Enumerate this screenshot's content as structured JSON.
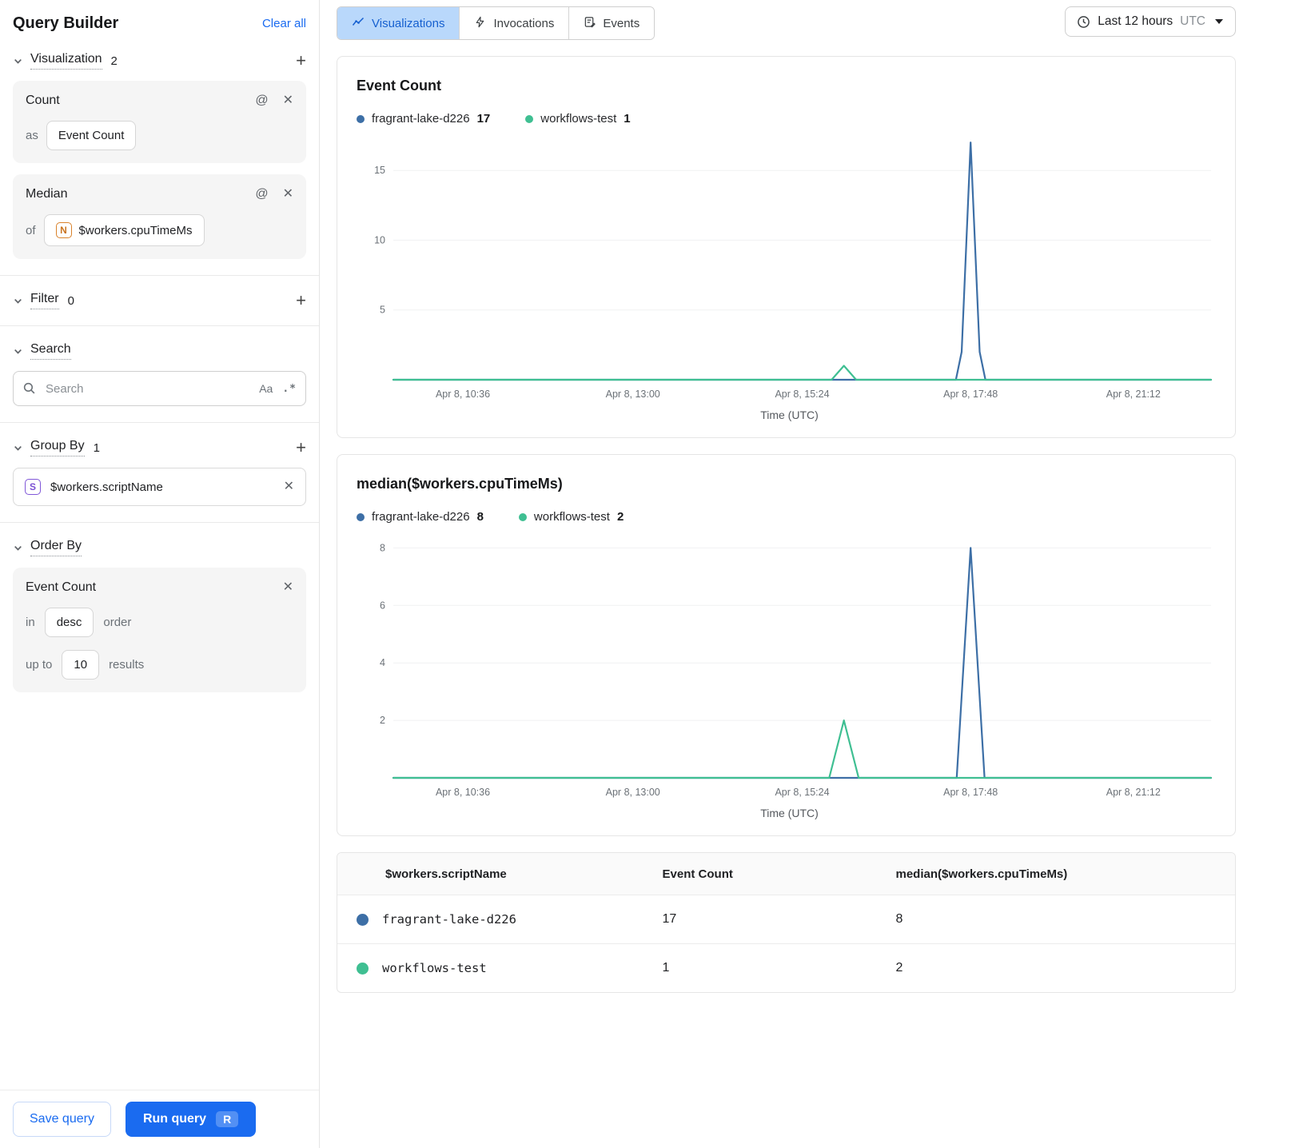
{
  "colors": {
    "accent_blue": "#1a6bf0",
    "series_blue": "#3d6fa6",
    "series_green": "#3fbf92",
    "selected_tab_bg": "#b9d8fb"
  },
  "sidebar": {
    "title": "Query Builder",
    "clear_all_label": "Clear all",
    "visualization": {
      "label": "Visualization",
      "count": "2"
    },
    "cards": [
      {
        "title": "Count",
        "row_prefix": "as",
        "chip": "Event Count"
      },
      {
        "title": "Median",
        "row_prefix": "of",
        "chip_badge": "N",
        "chip": "$workers.cpuTimeMs"
      }
    ],
    "filter": {
      "label": "Filter",
      "count": "0"
    },
    "search": {
      "label": "Search",
      "placeholder": "Search",
      "case_label": "Aa",
      "regex_label": ".*"
    },
    "group_by": {
      "label": "Group By",
      "count": "1",
      "item": {
        "badge": "S",
        "label": "$workers.scriptName"
      }
    },
    "order_by": {
      "label": "Order By",
      "card": {
        "title": "Event Count",
        "in_label": "in",
        "order_value": "desc",
        "order_suffix": "order",
        "up_to_label": "up to",
        "limit_value": "10",
        "results_suffix": "results"
      }
    },
    "save_label": "Save query",
    "run_label": "Run query",
    "run_shortcut": "R"
  },
  "header": {
    "tabs": [
      {
        "label": "Visualizations"
      },
      {
        "label": "Invocations"
      },
      {
        "label": "Events"
      }
    ],
    "time_range": {
      "label": "Last 12 hours",
      "zone": "UTC"
    }
  },
  "chart_data": [
    {
      "type": "line",
      "title": "Event Count",
      "xlabel": "Time (UTC)",
      "ylim": [
        0,
        17.3
      ],
      "y_ticks": [
        5,
        10,
        15
      ],
      "x_ticks": [
        {
          "frac": 0.085,
          "label": "Apr 8, 10:36"
        },
        {
          "frac": 0.293,
          "label": "Apr 8, 13:00"
        },
        {
          "frac": 0.5,
          "label": "Apr 8, 15:24"
        },
        {
          "frac": 0.706,
          "label": "Apr 8, 17:48"
        },
        {
          "frac": 0.905,
          "label": "Apr 8, 21:12"
        }
      ],
      "legend": [
        {
          "name": "fragrant-lake-d226",
          "value": "17",
          "color": "#3d6fa6"
        },
        {
          "name": "workflows-test",
          "value": "1",
          "color": "#3fbf92"
        }
      ],
      "series": [
        {
          "name": "fragrant-lake-d226",
          "color": "#3d6fa6",
          "points": [
            [
              0,
              0
            ],
            [
              0.688,
              0
            ],
            [
              0.695,
              2
            ],
            [
              0.706,
              17
            ],
            [
              0.717,
              2
            ],
            [
              0.724,
              0
            ],
            [
              1,
              0
            ]
          ]
        },
        {
          "name": "workflows-test",
          "color": "#3fbf92",
          "points": [
            [
              0,
              0
            ],
            [
              0.536,
              0
            ],
            [
              0.551,
              1
            ],
            [
              0.566,
              0
            ],
            [
              1,
              0
            ]
          ]
        }
      ]
    },
    {
      "type": "line",
      "title": "median($workers.cpuTimeMs)",
      "xlabel": "Time (UTC)",
      "ylim": [
        0,
        8.4
      ],
      "y_ticks": [
        2,
        4,
        6,
        8
      ],
      "x_ticks": [
        {
          "frac": 0.085,
          "label": "Apr 8, 10:36"
        },
        {
          "frac": 0.293,
          "label": "Apr 8, 13:00"
        },
        {
          "frac": 0.5,
          "label": "Apr 8, 15:24"
        },
        {
          "frac": 0.706,
          "label": "Apr 8, 17:48"
        },
        {
          "frac": 0.905,
          "label": "Apr 8, 21:12"
        }
      ],
      "legend": [
        {
          "name": "fragrant-lake-d226",
          "value": "8",
          "color": "#3d6fa6"
        },
        {
          "name": "workflows-test",
          "value": "2",
          "color": "#3fbf92"
        }
      ],
      "series": [
        {
          "name": "fragrant-lake-d226",
          "color": "#3d6fa6",
          "points": [
            [
              0,
              0
            ],
            [
              0.689,
              0
            ],
            [
              0.706,
              8
            ],
            [
              0.723,
              0
            ],
            [
              1,
              0
            ]
          ]
        },
        {
          "name": "workflows-test",
          "color": "#3fbf92",
          "points": [
            [
              0,
              0
            ],
            [
              0.533,
              0
            ],
            [
              0.551,
              2
            ],
            [
              0.569,
              0
            ],
            [
              1,
              0
            ]
          ]
        }
      ]
    }
  ],
  "table": {
    "headers": [
      "$workers.scriptName",
      "Event Count",
      "median($workers.cpuTimeMs)"
    ],
    "rows": [
      {
        "color": "#3d6fa6",
        "name": "fragrant-lake-d226",
        "event_count": "17",
        "median": "8"
      },
      {
        "color": "#3fbf92",
        "name": "workflows-test",
        "event_count": "1",
        "median": "2"
      }
    ]
  }
}
